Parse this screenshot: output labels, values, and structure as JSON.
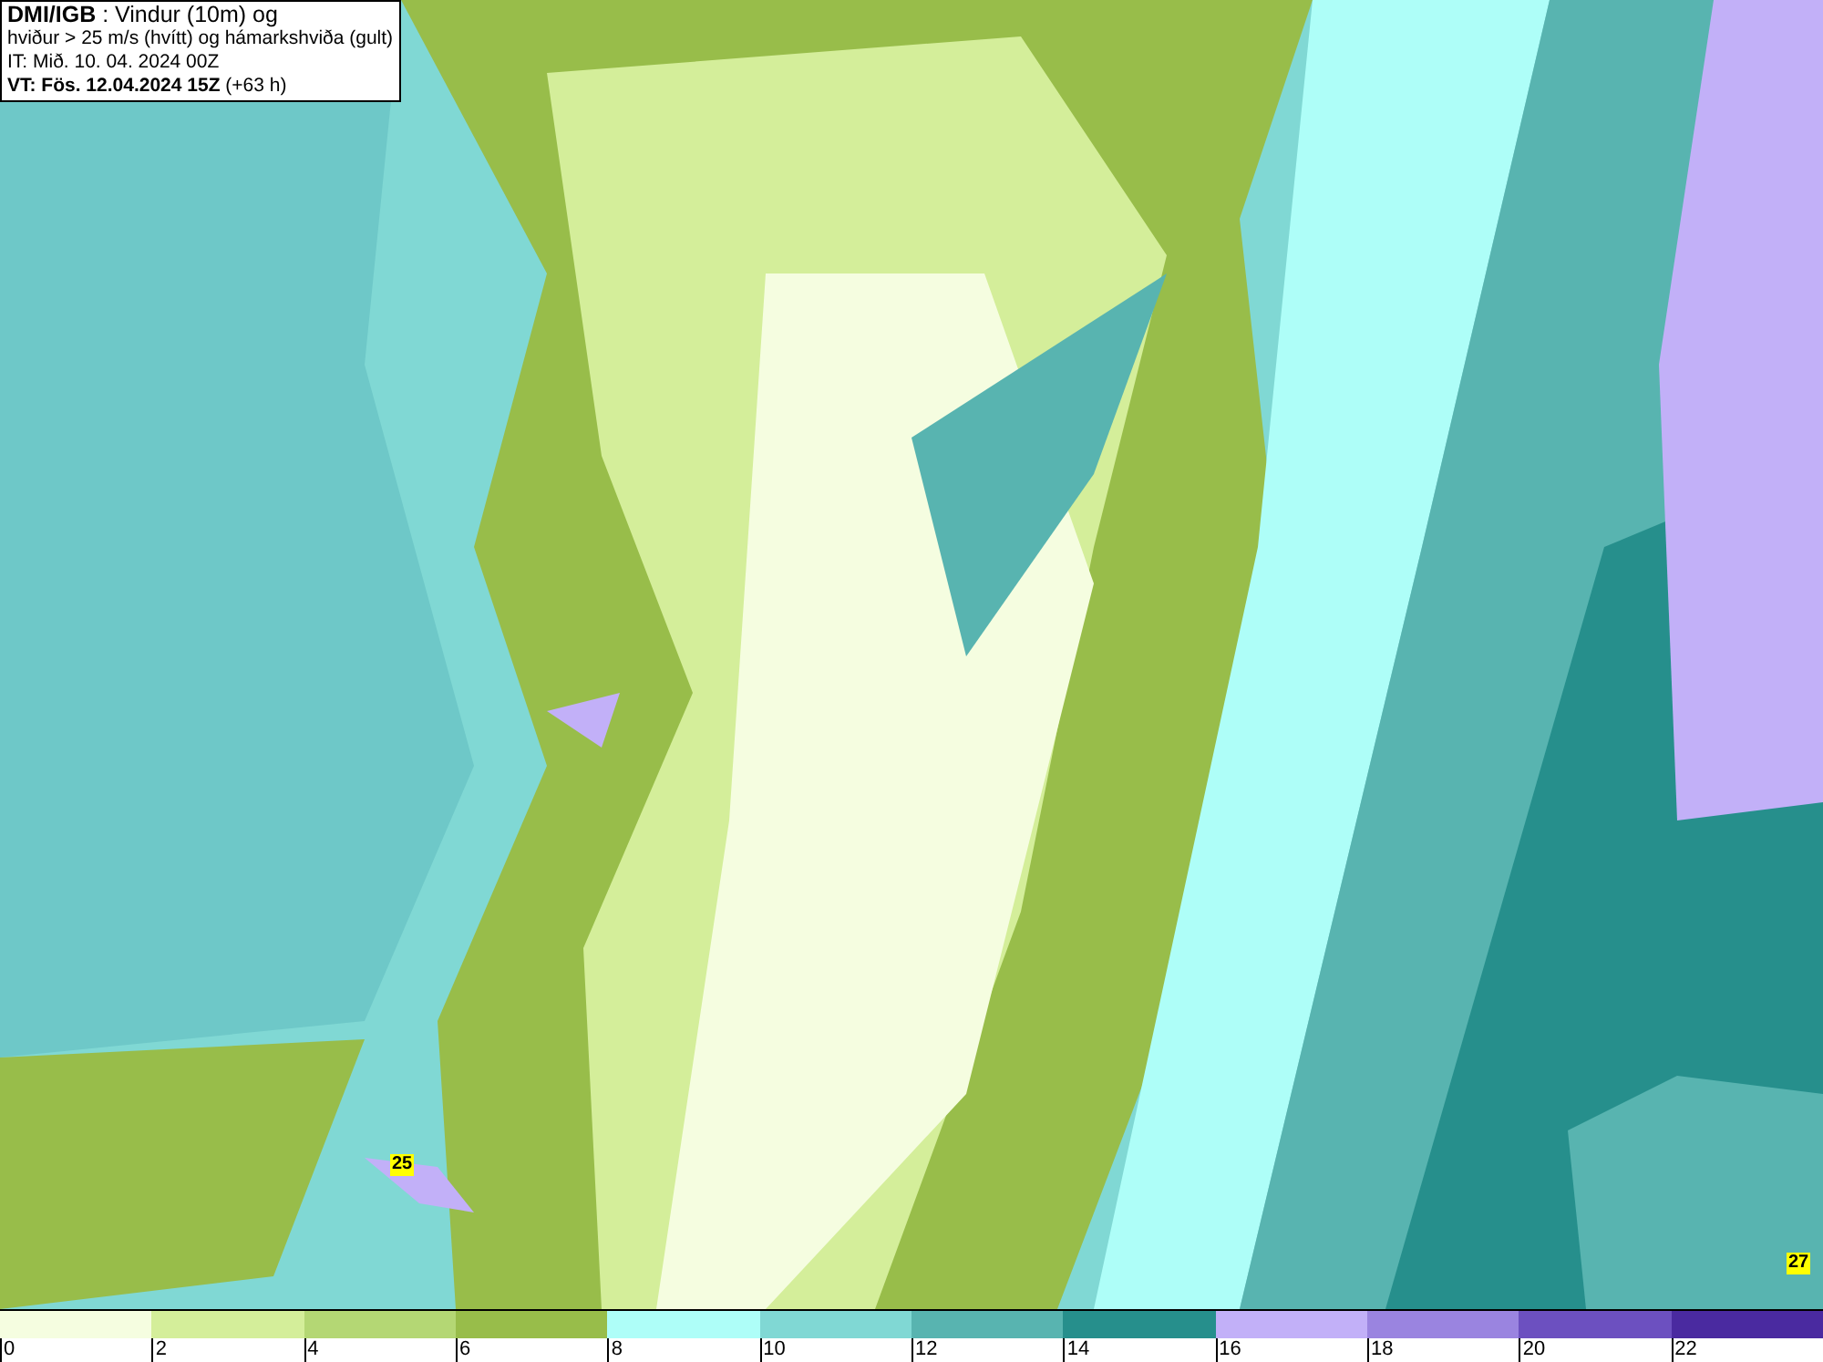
{
  "header": {
    "lines": [
      "**DMI/IGB** : Vindur (10m) og",
      "hviður > 25 m/s (hvítt) og hámarkshviða (gult)",
      "IT: Mið. 10. 04. 2024 00Z",
      "**VT: Fös. 12.04.2024 15Z** (+63 h)"
    ]
  },
  "map": {
    "gust_labels": [
      {
        "text": "25"
      },
      {
        "text": "27"
      }
    ]
  },
  "legend": [
    {
      "label": "0",
      "color": "#f5fde0"
    },
    {
      "label": "2",
      "color": "#d4ee9a"
    },
    {
      "label": "4",
      "color": "#b4d774"
    },
    {
      "label": "6",
      "color": "#98bd4a"
    },
    {
      "label": "8",
      "color": "#aefef8"
    },
    {
      "label": "10",
      "color": "#80d8d4"
    },
    {
      "label": "12",
      "color": "#58b4b0"
    },
    {
      "label": "14",
      "color": "#268f8c"
    },
    {
      "label": "16",
      "color": "#c2b0f8"
    },
    {
      "label": "18",
      "color": "#9a84e0"
    },
    {
      "label": "20",
      "color": "#6c50c0"
    },
    {
      "label": "22",
      "color": "#4a2aa0"
    }
  ]
}
